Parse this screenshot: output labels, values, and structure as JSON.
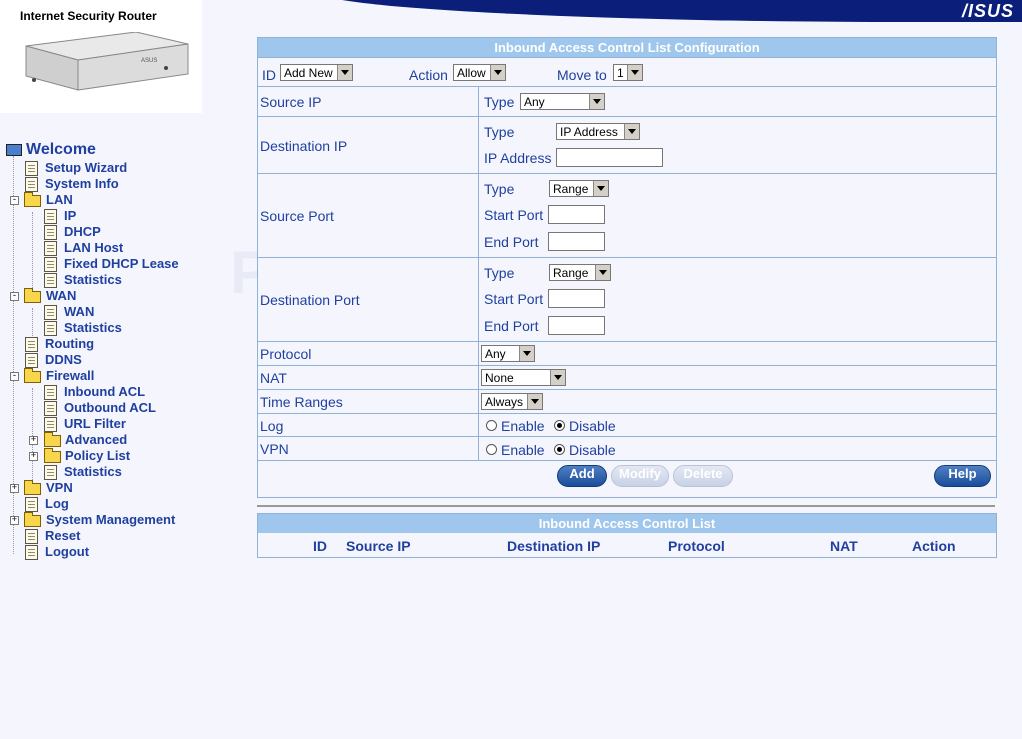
{
  "brand": {
    "product_title": "Internet Security Router",
    "logo_text": "/ISUS",
    "router_label": "ASUS"
  },
  "nav": {
    "welcome": "Welcome",
    "setup_wizard": "Setup Wizard",
    "system_info": "System Info",
    "lan": "LAN",
    "lan_ip": "IP",
    "lan_dhcp": "DHCP",
    "lan_host": "LAN Host",
    "fixed_dhcp": "Fixed DHCP Lease",
    "lan_stats": "Statistics",
    "wan": "WAN",
    "wan_wan": "WAN",
    "wan_stats": "Statistics",
    "routing": "Routing",
    "ddns": "DDNS",
    "firewall": "Firewall",
    "inbound_acl": "Inbound ACL",
    "outbound_acl": "Outbound ACL",
    "url_filter": "URL Filter",
    "advanced": "Advanced",
    "policy_list": "Policy List",
    "fw_stats": "Statistics",
    "vpn": "VPN",
    "log": "Log",
    "system_management": "System Management",
    "reset": "Reset",
    "logout": "Logout"
  },
  "form": {
    "title": "Inbound Access Control List Configuration",
    "id_label": "ID",
    "id_value": "Add New",
    "action_label": "Action",
    "action_value": "Allow",
    "moveto_label": "Move to",
    "moveto_value": "1",
    "source_ip": "Source IP",
    "type_label": "Type",
    "source_ip_type": "Any",
    "dest_ip": "Destination IP",
    "dest_ip_type": "IP Address",
    "ip_address_label": "IP Address",
    "source_port": "Source Port",
    "sp_type": "Range",
    "start_port_label": "Start Port",
    "end_port_label": "End Port",
    "dest_port": "Destination Port",
    "dp_type": "Range",
    "protocol": "Protocol",
    "protocol_value": "Any",
    "nat": "NAT",
    "nat_value": "None",
    "time_ranges": "Time Ranges",
    "time_value": "Always",
    "log": "Log",
    "vpn": "VPN",
    "enable": "Enable",
    "disable": "Disable",
    "add": "Add",
    "modify": "Modify",
    "delete": "Delete",
    "help": "Help"
  },
  "list": {
    "title": "Inbound Access Control List",
    "columns": [
      "ID",
      "Source IP",
      "Destination IP",
      "Protocol",
      "NAT",
      "Action"
    ]
  },
  "watermark": "PcWinTech.com",
  "colors": {
    "header": "#9fc6ec",
    "link": "#2040a0",
    "banner": "#0b1f7a"
  }
}
